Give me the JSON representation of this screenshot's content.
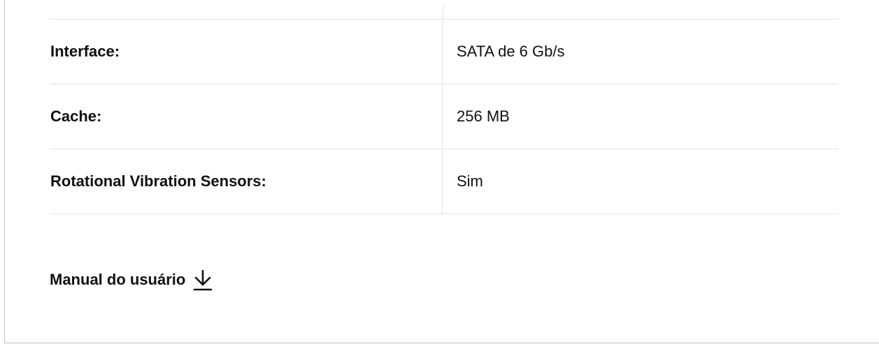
{
  "specs": {
    "rows": [
      {
        "label": "Interface:",
        "value": "SATA de 6 Gb/s"
      },
      {
        "label": "Cache:",
        "value": "256 MB"
      },
      {
        "label": "Rotational Vibration Sensors:",
        "value": "Sim"
      }
    ]
  },
  "manual": {
    "label": "Manual do usuário",
    "icon": "download-icon"
  },
  "colors": {
    "text": "#111111",
    "divider": "#e2e2e2",
    "border": "#bdbdbd"
  }
}
